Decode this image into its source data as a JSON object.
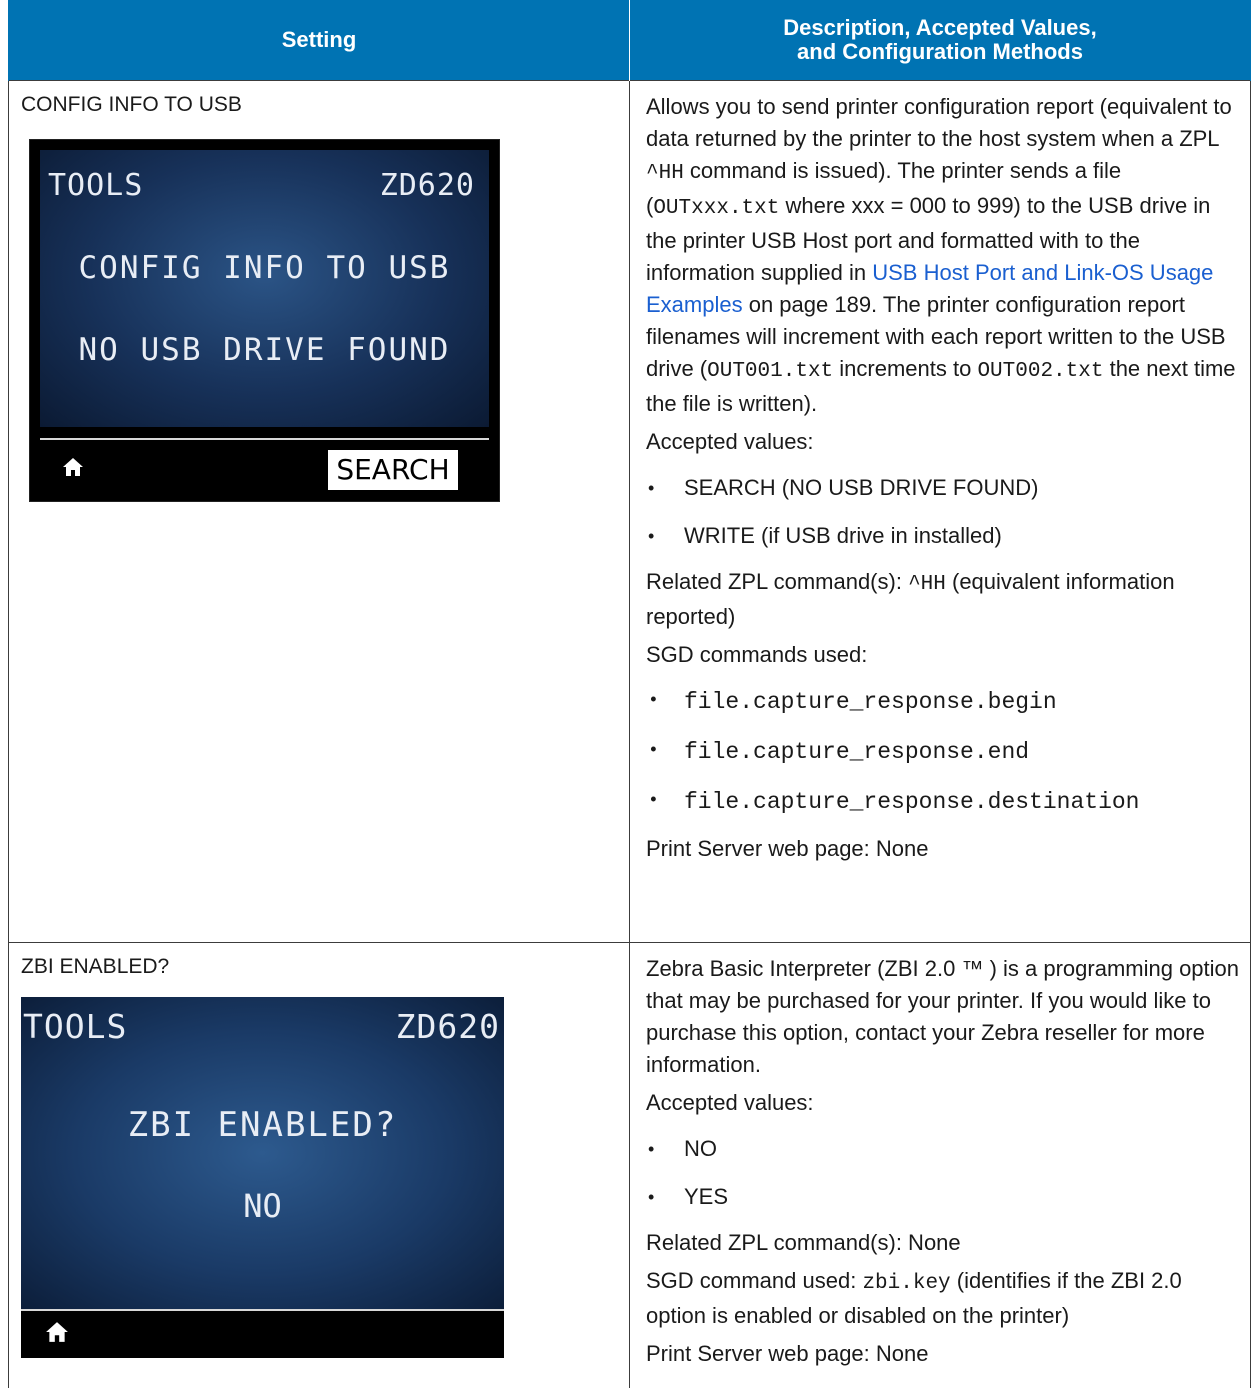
{
  "header": {
    "col_setting": "Setting",
    "col_desc_line1": "Description, Accepted Values,",
    "col_desc_line2": "and Configuration Methods"
  },
  "row1": {
    "setting": "CONFIG INFO TO USB",
    "screen": {
      "left_title": "TOOLS",
      "right_title": "ZD620",
      "main_text": "CONFIG INFO TO USB",
      "status_text": "NO USB DRIVE FOUND",
      "button": "SEARCH",
      "home_icon": "home-icon"
    },
    "desc": {
      "p1_a": "Allows you to send printer configuration report (equivalent to data returned by the printer to the host system when a ZPL ",
      "p1_code1": "^HH",
      "p1_b": " command is issued). The printer sends a file (",
      "p1_code2": "OUTxxx.txt",
      "p1_c": " where xxx = 000 to 999) to the USB drive in the printer USB Host port and formatted with to the information supplied in ",
      "p1_link": "USB Host Port and Link-OS Usage Examples",
      "p1_d": " on page 189. The printer configuration report filenames will increment with each report written to the USB drive (",
      "p1_code3": "OUT001.txt",
      "p1_e": " increments to ",
      "p1_code4": "OUT002.txt",
      "p1_f": " the next time the file is written).",
      "accepted_label": "Accepted values:",
      "values": [
        "SEARCH (NO USB DRIVE FOUND)",
        "WRITE (if USB drive in installed)"
      ],
      "zpl_a": "Related ZPL command(s): ",
      "zpl_code": "^HH",
      "zpl_b": " (equivalent information reported)",
      "sgd_label": "SGD commands used:",
      "sgd_cmds": [
        "file.capture_response.begin",
        "file.capture_response.end",
        "file.capture_response.destination"
      ],
      "web": "Print Server web page: None"
    }
  },
  "row2": {
    "setting": "ZBI ENABLED?",
    "screen": {
      "left_title": "TOOLS",
      "right_title": "ZD620",
      "main_text": "ZBI ENABLED?",
      "value_text": "NO",
      "home_icon": "home-icon"
    },
    "desc": {
      "p1": "Zebra Basic Interpreter (ZBI 2.0 ™ ) is a programming option that may be purchased for your printer. If you would like to purchase this option, contact your Zebra reseller for more information.",
      "accepted_label": "Accepted values:",
      "values": [
        "NO",
        "YES"
      ],
      "zpl": "Related ZPL command(s): None",
      "sgd_a": "SGD command used: ",
      "sgd_code": "zbi.key",
      "sgd_b": " (identifies if the ZBI 2.0 option is enabled or disabled on the printer)",
      "web": "Print Server web page: None"
    }
  },
  "bullet": "•",
  "colors": {
    "header_bg": "#0073b3",
    "link": "#1a5fd0"
  }
}
